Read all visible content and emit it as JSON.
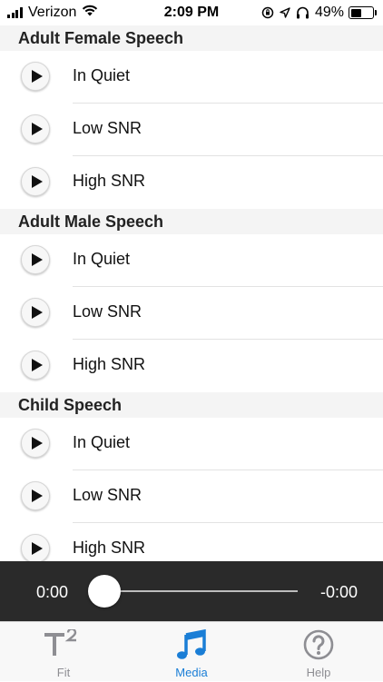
{
  "status": {
    "carrier": "Verizon",
    "time": "2:09 PM",
    "battery": "49%",
    "battery_level": 0.49
  },
  "sections": [
    {
      "title": "Adult Female Speech",
      "items": [
        {
          "label": "In Quiet",
          "icon": "play-icon"
        },
        {
          "label": "Low SNR",
          "icon": "play-icon"
        },
        {
          "label": "High SNR",
          "icon": "play-icon"
        }
      ]
    },
    {
      "title": "Adult Male Speech",
      "items": [
        {
          "label": "In Quiet",
          "icon": "play-icon"
        },
        {
          "label": "Low SNR",
          "icon": "play-icon"
        },
        {
          "label": "High SNR",
          "icon": "play-icon"
        }
      ]
    },
    {
      "title": "Child Speech",
      "items": [
        {
          "label": "In Quiet",
          "icon": "play-icon"
        },
        {
          "label": "Low SNR",
          "icon": "play-icon"
        },
        {
          "label": "High SNR",
          "icon": "play-icon"
        }
      ]
    }
  ],
  "player": {
    "elapsed": "0:00",
    "remaining": "-0:00",
    "progress": 0
  },
  "tabs": [
    {
      "label": "Fit",
      "icon": "t-squared-icon",
      "active": false
    },
    {
      "label": "Media",
      "icon": "music-note-icon",
      "active": true
    },
    {
      "label": "Help",
      "icon": "question-icon",
      "active": false
    }
  ],
  "colors": {
    "accent": "#1a7ed6",
    "player_bg": "#2a2a2a",
    "section_bg": "#f4f4f4"
  }
}
